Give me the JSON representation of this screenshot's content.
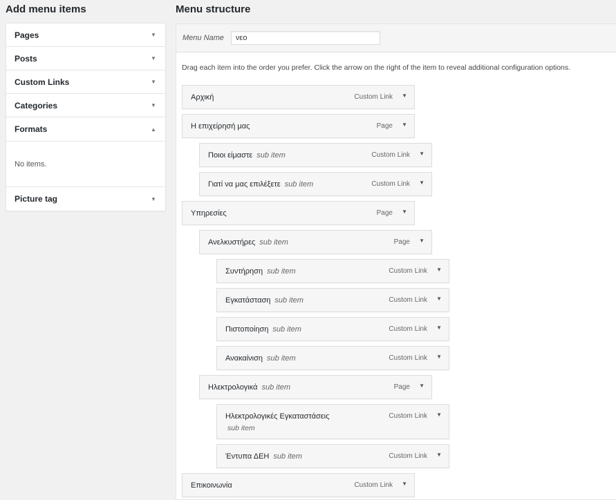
{
  "left": {
    "heading": "Add menu items",
    "sections": [
      {
        "label": "Pages",
        "open": false
      },
      {
        "label": "Posts",
        "open": false
      },
      {
        "label": "Custom Links",
        "open": false
      },
      {
        "label": "Categories",
        "open": false
      },
      {
        "label": "Formats",
        "open": true,
        "body": "No items."
      },
      {
        "label": "Picture tag",
        "open": false
      }
    ]
  },
  "right": {
    "heading": "Menu structure",
    "menu_name_label": "Menu Name",
    "menu_name_value": "νεο",
    "instructions": "Drag each item into the order you prefer. Click the arrow on the right of the item to reveal additional configuration options.",
    "items": [
      {
        "title": "Αρχική",
        "sub": "",
        "type": "Custom Link",
        "depth": 0
      },
      {
        "title": "Η επιχείρησή μας",
        "sub": "",
        "type": "Page",
        "depth": 0
      },
      {
        "title": "Ποιοι είμαστε",
        "sub": "sub item",
        "type": "Custom Link",
        "depth": 1
      },
      {
        "title": "Γιατί να μας επιλέξετε",
        "sub": "sub item",
        "type": "Custom Link",
        "depth": 1
      },
      {
        "title": "Υπηρεσίες",
        "sub": "",
        "type": "Page",
        "depth": 0
      },
      {
        "title": "Ανελκυστήρες",
        "sub": "sub item",
        "type": "Page",
        "depth": 1
      },
      {
        "title": "Συντήρηση",
        "sub": "sub item",
        "type": "Custom Link",
        "depth": 2
      },
      {
        "title": "Εγκατάσταση",
        "sub": "sub item",
        "type": "Custom Link",
        "depth": 2
      },
      {
        "title": "Πιστοποίηση",
        "sub": "sub item",
        "type": "Custom Link",
        "depth": 2
      },
      {
        "title": "Ανακαίνιση",
        "sub": "sub item",
        "type": "Custom Link",
        "depth": 2
      },
      {
        "title": "Ηλεκτρολογικά",
        "sub": "sub item",
        "type": "Page",
        "depth": 1
      },
      {
        "title": "Ηλεκτρολογικές Εγκαταστάσεις",
        "sub": "sub item",
        "type": "Custom Link",
        "depth": 2,
        "wrap": true
      },
      {
        "title": "Έντυπα ΔΕΗ",
        "sub": "sub item",
        "type": "Custom Link",
        "depth": 2
      },
      {
        "title": "Επικοινωνία",
        "sub": "",
        "type": "Custom Link",
        "depth": 0
      }
    ]
  },
  "icons": {
    "collapsed": "triangle-down",
    "expanded": "triangle-up"
  }
}
